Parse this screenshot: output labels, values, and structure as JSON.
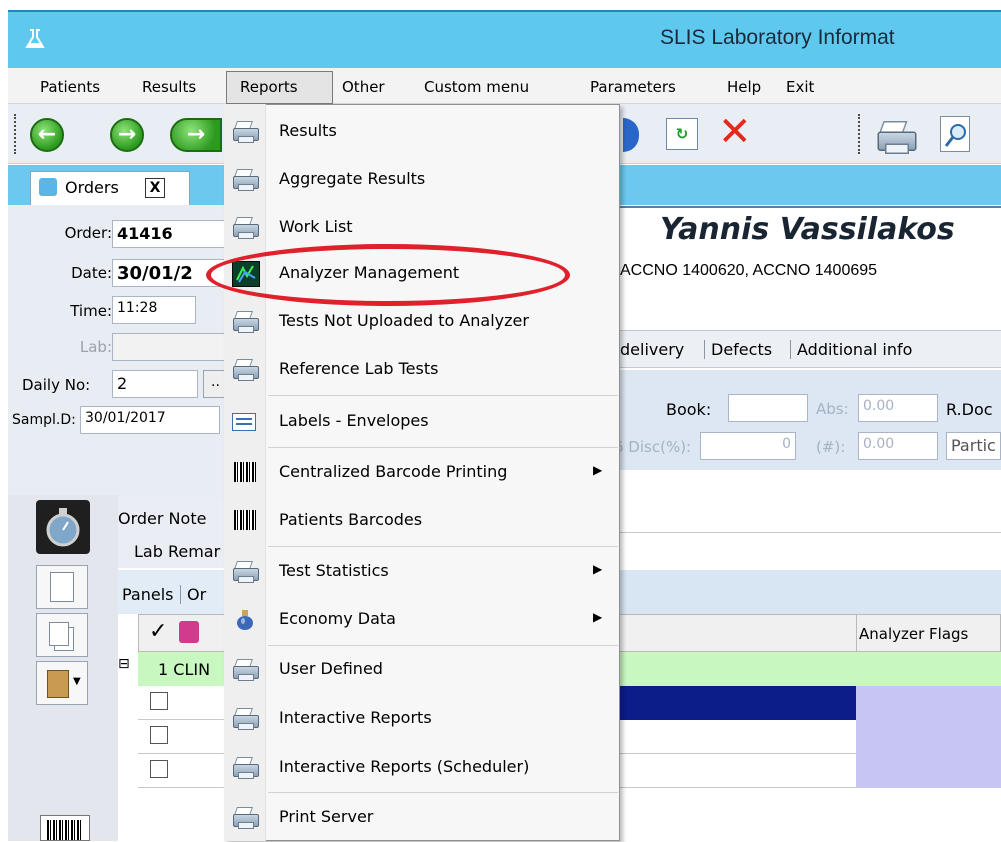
{
  "window": {
    "title": "SLIS Laboratory Informat"
  },
  "menubar": {
    "items": [
      "Patients",
      "Results",
      "Reports",
      "Other",
      "Custom menu",
      "Parameters",
      "Help",
      "Exit"
    ]
  },
  "tabs": {
    "orders_label": "Orders",
    "close_glyph": "X"
  },
  "form": {
    "order_label": "Order:",
    "order_value": "41416",
    "date_label": "Date:",
    "date_value": "30/01/2",
    "time_label": "Time:",
    "time_value": "11:28",
    "lab_label": "Lab:",
    "lab_value": "",
    "daily_label": "Daily No:",
    "daily_value": "2",
    "daily_button": "..",
    "sampl_label": "Sampl.D:",
    "sampl_value": "30/01/2017"
  },
  "patient": {
    "name": "Yannis Vassilakos",
    "accno": "ACCNO 1400620, ACCNO 1400695"
  },
  "detail_tabs": [
    "delivery",
    "Defects",
    "Additional info"
  ],
  "detail_fields": {
    "book_label": "Book:",
    "abs_label": "Abs:",
    "abs_value": "0.00",
    "rdoc_label": "R.Doc",
    "disc_label": "6 Disc(%):",
    "disc_value": "0",
    "hash_label": "(#):",
    "hash_value": "0.00",
    "partic_label": "Partic"
  },
  "notes": {
    "order_note_label": "Order Note",
    "lab_remark_label": "Lab Remar"
  },
  "panels_row": {
    "panels_label": "Panels",
    "other_label": "Or"
  },
  "grid": {
    "header_check": "✓",
    "analyzer_flags_label": "Analyzer Flags",
    "group_label": "1 CLIN",
    "expand_glyph": "⊟"
  },
  "reports_menu": {
    "items": [
      {
        "label": "Results",
        "icon": "printer-icon",
        "submenu": false
      },
      {
        "label": "Aggregate Results",
        "icon": "printer-icon",
        "submenu": false
      },
      {
        "label": "Work List",
        "icon": "printer-icon",
        "submenu": false
      },
      {
        "label": "Analyzer Management",
        "icon": "analyzer-icon",
        "submenu": false
      },
      {
        "label": "Tests Not Uploaded to Analyzer",
        "icon": "printer-icon",
        "submenu": false
      },
      {
        "label": "Reference Lab Tests",
        "icon": "printer-icon",
        "submenu": false
      },
      {
        "label": "Labels - Envelopes",
        "icon": "label-icon",
        "submenu": false
      },
      {
        "label": "Centralized Barcode Printing",
        "icon": "barcode-icon",
        "submenu": true
      },
      {
        "label": "Patients Barcodes",
        "icon": "barcode-icon",
        "submenu": false
      },
      {
        "label": "Test Statistics",
        "icon": "printer-icon",
        "submenu": true
      },
      {
        "label": "Economy Data",
        "icon": "money-bag-icon",
        "submenu": true
      },
      {
        "label": "User Defined",
        "icon": "printer-icon",
        "submenu": false
      },
      {
        "label": "Interactive Reports",
        "icon": "printer-icon",
        "submenu": false
      },
      {
        "label": "Interactive Reports (Scheduler)",
        "icon": "printer-icon",
        "submenu": false
      },
      {
        "label": "Print Server",
        "icon": "printer-icon",
        "submenu": false
      }
    ],
    "highlight_color": "#e0202a"
  }
}
